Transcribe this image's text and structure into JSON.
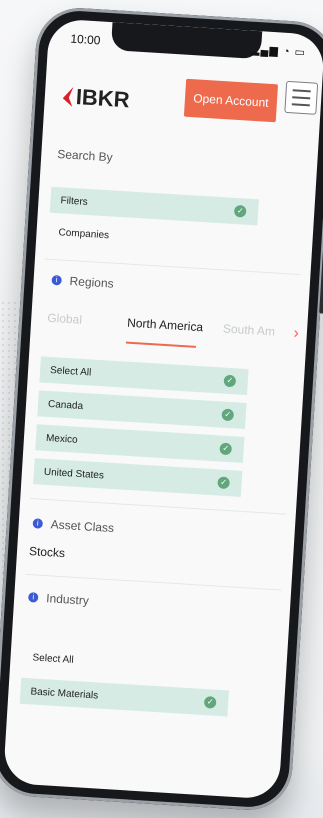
{
  "status_bar": {
    "time": "10:00",
    "icons": "signal-wifi-battery"
  },
  "header": {
    "logo_text": "IBKR",
    "open_account_label": "Open Account"
  },
  "search_by": {
    "label": "Search By",
    "options": [
      {
        "label": "Filters",
        "selected": true
      },
      {
        "label": "Companies",
        "selected": false
      }
    ]
  },
  "regions": {
    "label": "Regions",
    "tabs": [
      "Global",
      "North America",
      "South Am"
    ],
    "active_tab": "North America",
    "options": [
      {
        "label": "Select All",
        "selected": true
      },
      {
        "label": "Canada",
        "selected": true
      },
      {
        "label": "Mexico",
        "selected": true
      },
      {
        "label": "United States",
        "selected": true
      }
    ]
  },
  "asset_class": {
    "label": "Asset Class",
    "value": "Stocks"
  },
  "industry": {
    "label": "Industry",
    "options": [
      {
        "label": "Select All",
        "selected": false
      },
      {
        "label": "Basic Materials",
        "selected": true
      }
    ]
  },
  "colors": {
    "accent": "#ed6a4d",
    "check": "#62a77b",
    "selected_bg": "#d5ebe3",
    "info": "#3b5bd6"
  }
}
